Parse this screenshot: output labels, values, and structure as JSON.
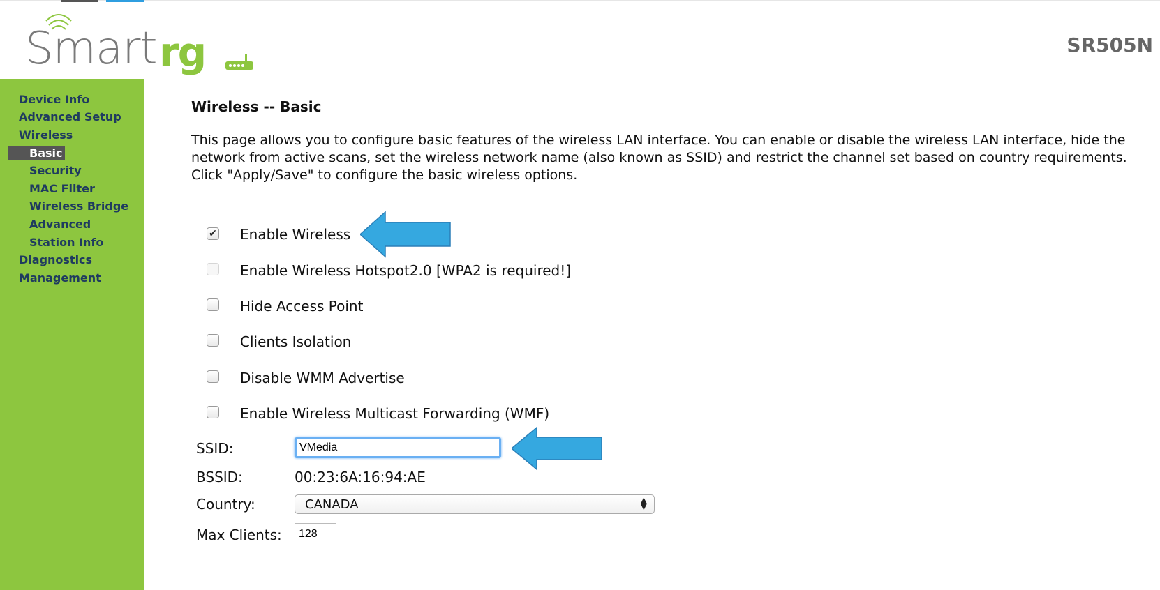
{
  "brand": {
    "logo_word": "Smart",
    "logo_accent": "rg",
    "model": "SR505N"
  },
  "sidebar": {
    "items": [
      {
        "label": "Device Info",
        "level": "top"
      },
      {
        "label": "Advanced Setup",
        "level": "top"
      },
      {
        "label": "Wireless",
        "level": "top"
      },
      {
        "label": "Basic",
        "level": "sub",
        "active": true
      },
      {
        "label": "Security",
        "level": "sub"
      },
      {
        "label": "MAC Filter",
        "level": "sub"
      },
      {
        "label": "Wireless Bridge",
        "level": "sub"
      },
      {
        "label": "Advanced",
        "level": "sub"
      },
      {
        "label": "Station Info",
        "level": "sub"
      },
      {
        "label": "Diagnostics",
        "level": "top"
      },
      {
        "label": "Management",
        "level": "top"
      }
    ]
  },
  "page": {
    "title": "Wireless -- Basic",
    "description": "This page allows you to configure basic features of the wireless LAN interface. You can enable or disable the wireless LAN interface, hide the network from active scans, set the wireless network name (also known as SSID) and restrict the channel set based on country requirements.",
    "instruction": "Click \"Apply/Save\" to configure the basic wireless options."
  },
  "options": [
    {
      "label": "Enable Wireless",
      "checked": true,
      "disabled": false
    },
    {
      "label": "Enable Wireless Hotspot2.0 [WPA2 is required!]",
      "checked": false,
      "disabled": true
    },
    {
      "label": "Hide Access Point",
      "checked": false,
      "disabled": false
    },
    {
      "label": "Clients Isolation",
      "checked": false,
      "disabled": false
    },
    {
      "label": "Disable WMM Advertise",
      "checked": false,
      "disabled": false
    },
    {
      "label": "Enable Wireless Multicast Forwarding (WMF)",
      "checked": false,
      "disabled": false
    }
  ],
  "fields": {
    "ssid": {
      "label": "SSID:",
      "value": "VMedia"
    },
    "bssid": {
      "label": "BSSID:",
      "value": "00:23:6A:16:94:AE"
    },
    "country": {
      "label": "Country:",
      "value": "CANADA"
    },
    "max_clients": {
      "label": "Max Clients:",
      "value": "128"
    }
  },
  "colors": {
    "sidebar_green": "#8dc63f",
    "nav_text": "#1f3b5f",
    "arrow_blue": "#35a8e0",
    "active_nav_bg": "#555555"
  }
}
